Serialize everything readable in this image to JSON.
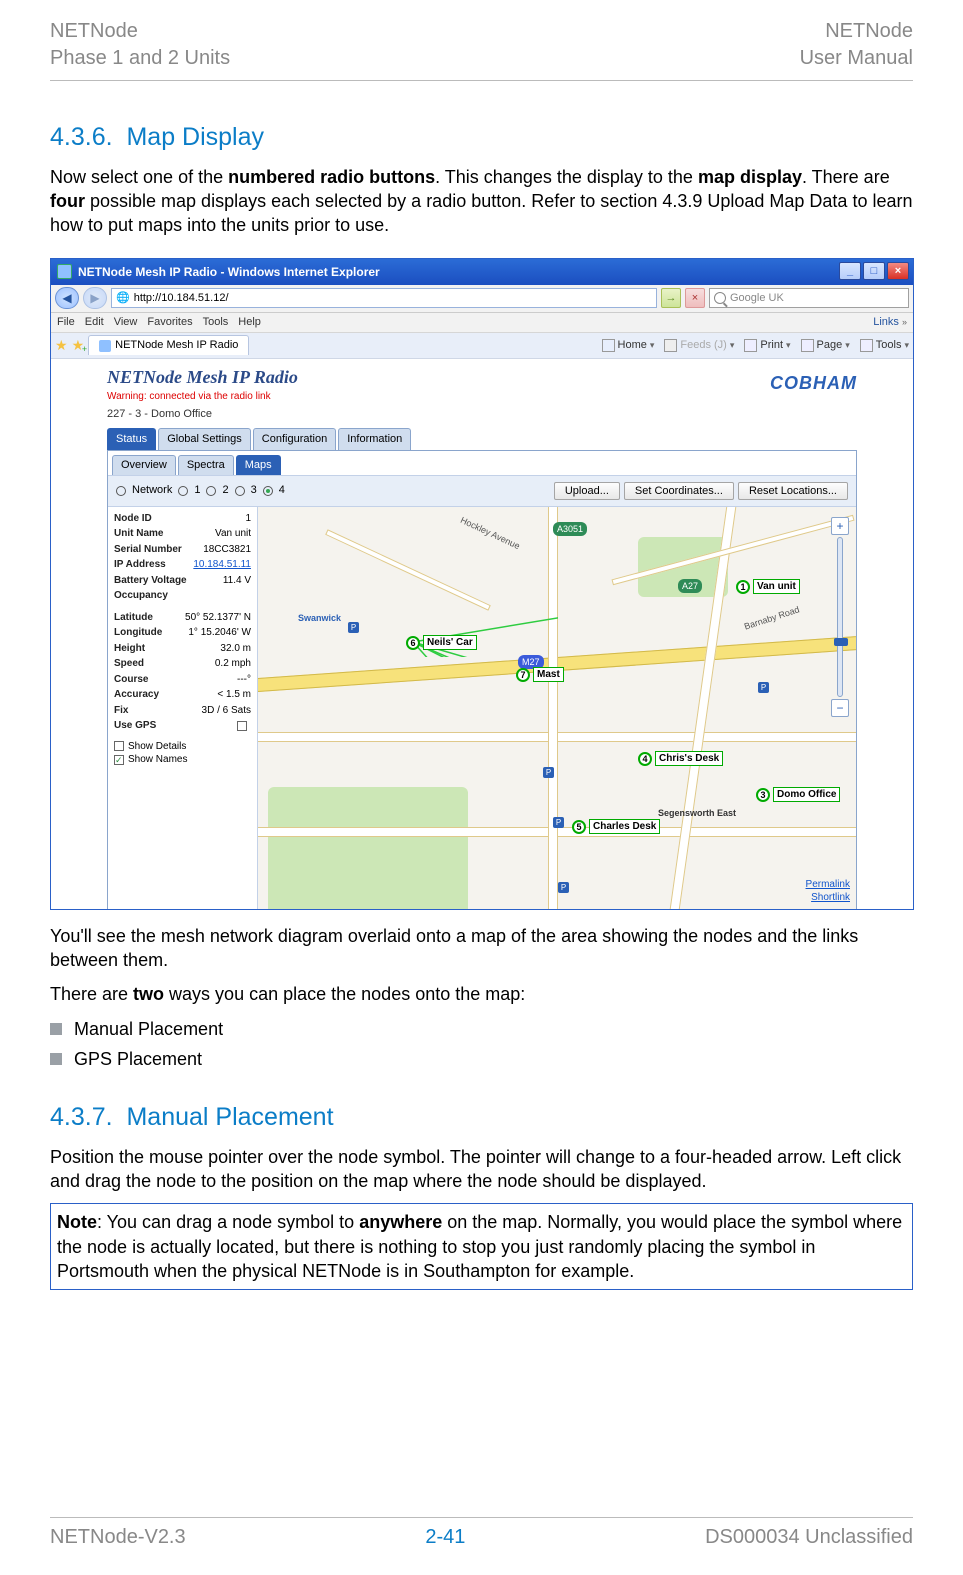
{
  "header": {
    "tl": "NETNode",
    "bl": "Phase 1 and 2 Units",
    "tr": "NETNode",
    "br": "User Manual"
  },
  "footer": {
    "left": "NETNode-V2.3",
    "center": "2-41",
    "right": "DS000034 Unclassified"
  },
  "sec1": {
    "num": "4.3.6.",
    "title": "Map Display",
    "p1a": "Now select one of the ",
    "p1b": "numbered radio buttons",
    "p1c": ". This changes the display to the ",
    "p1d": "map display",
    "p1e": ". There are ",
    "p1f": "four",
    "p1g": " possible map displays each selected by a radio button. Refer to section 4.3.9 Upload Map Data to learn how to put maps into the units prior to use."
  },
  "post": {
    "p2": "You'll see the mesh network diagram overlaid onto a map of the area showing the nodes and the links between them.",
    "p3a": "There are ",
    "p3b": "two",
    "p3c": " ways you can place the nodes onto the map:",
    "b1": "Manual Placement",
    "b2": "GPS Placement"
  },
  "sec2": {
    "num": "4.3.7.",
    "title": "Manual Placement",
    "p": "Position the mouse pointer over the node symbol. The pointer will change to a four-headed arrow. Left click and drag the node to the position on the map where the node should be displayed."
  },
  "note": {
    "a": "Note",
    "b": ": You can drag a node symbol to ",
    "c": "anywhere",
    "d": " on the map. Normally, you would place the symbol where the node is actually located, but there is nothing to stop you just randomly placing the symbol in Portsmouth when the physical NETNode is in Southampton for example."
  },
  "ie": {
    "title": "NETNode Mesh IP Radio - Windows Internet Explorer",
    "url_prefix": "🌐 ",
    "url": "http://10.184.51.12/",
    "menus": [
      "File",
      "Edit",
      "View",
      "Favorites",
      "Tools",
      "Help"
    ],
    "links": "Links",
    "tabname": "NETNode Mesh IP Radio",
    "search_placeholder": "Google UK",
    "cmd": {
      "home": "Home",
      "feeds": "Feeds (J)",
      "print": "Print",
      "page": "Page",
      "tools": "Tools"
    }
  },
  "app": {
    "title": "NETNode Mesh IP Radio",
    "warn": "Warning: connected via the radio link",
    "brand": "COBHAM",
    "crumb": "227 - 3 - Domo Office",
    "tabs": [
      "Status",
      "Global Settings",
      "Configuration",
      "Information"
    ],
    "subtabs": [
      "Overview",
      "Spectra",
      "Maps"
    ],
    "radio_label": "Network",
    "radios": [
      "1",
      "2",
      "3",
      "4"
    ],
    "btns": {
      "upload": "Upload...",
      "setc": "Set Coordinates...",
      "reset": "Reset Locations..."
    },
    "side": {
      "NodeID": "1",
      "UnitName": "Van unit",
      "Serial": "18CC3821",
      "IP": "10.184.51.11",
      "Batt": "11.4 V",
      "Occ": "",
      "Lat": "50° 52.1377' N",
      "Lon": "1° 15.2046' W",
      "Height": "32.0 m",
      "Speed": "0.2 mph",
      "Course": "---°",
      "Acc": "< 1.5 m",
      "Fix": "3D / 6 Sats",
      "UseGPS_label": "Use GPS",
      "ShowDetails": "Show Details",
      "ShowNames": "Show Names",
      "k": {
        "NodeID": "Node ID",
        "UnitName": "Unit Name",
        "Serial": "Serial Number",
        "IP": "IP Address",
        "Batt": "Battery Voltage",
        "Occ": "Occupancy",
        "Lat": "Latitude",
        "Lon": "Longitude",
        "Height": "Height",
        "Speed": "Speed",
        "Course": "Course",
        "Acc": "Accuracy",
        "Fix": "Fix"
      }
    },
    "nodes": {
      "n1": "Van unit",
      "n3": "Domo Office",
      "n4": "Chris's Desk",
      "n5": "Charles Desk",
      "n6": "Neils' Car",
      "n7": "Mast"
    },
    "map": {
      "swanwick": "Swanwick",
      "segensworth": "Segensworth East",
      "m27": "M27",
      "a27": "A27",
      "a3051": "A3051",
      "hockley": "Hockley Avenue",
      "barnaby": "Barnaby Road",
      "permalink": "Permalink",
      "shortlink": "Shortlink"
    }
  }
}
